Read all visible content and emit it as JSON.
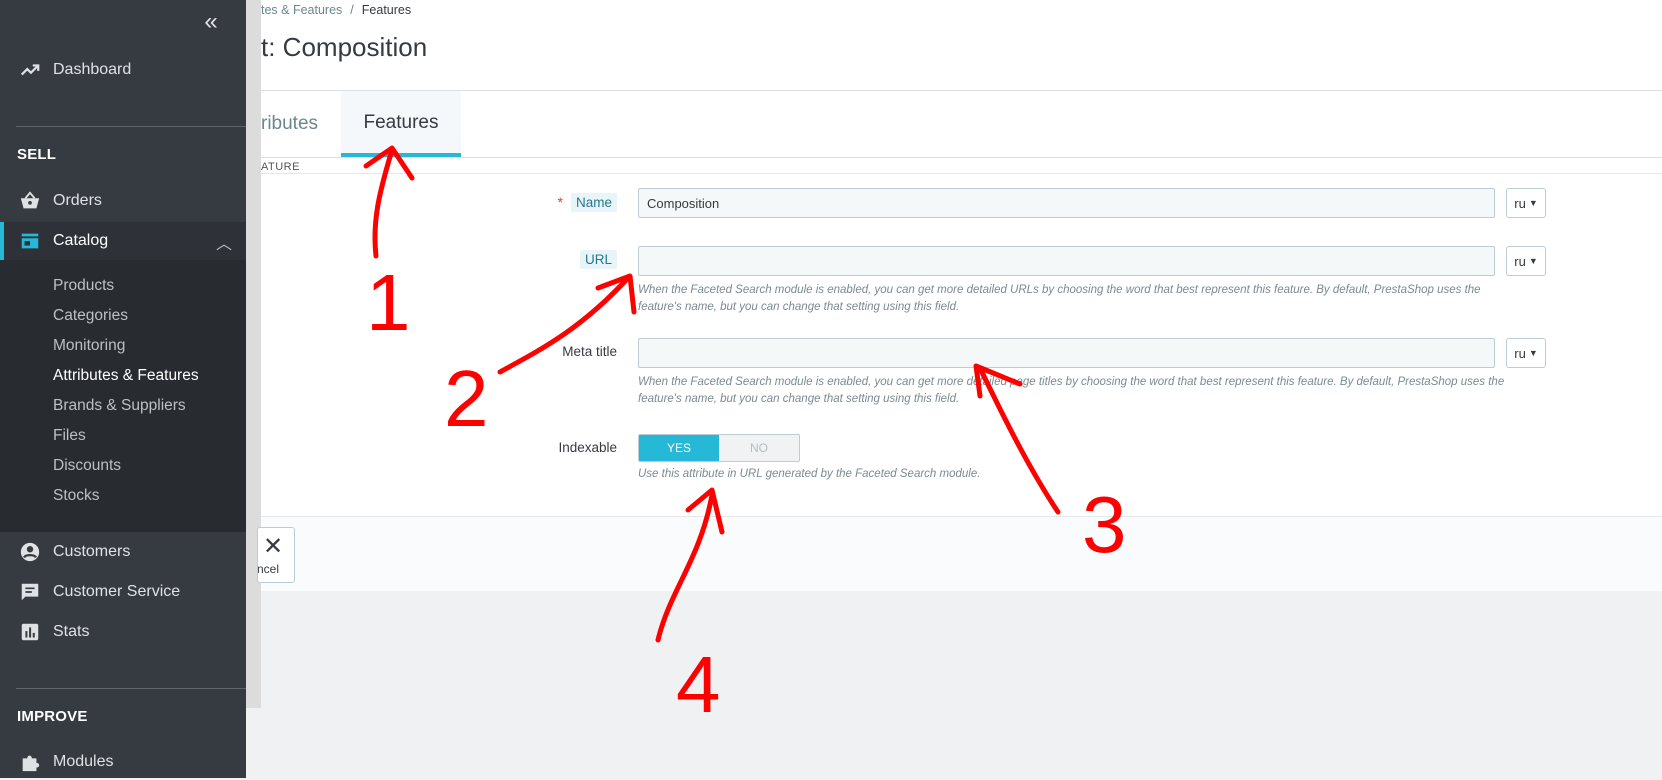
{
  "sidebar": {
    "collapse_icon": "double-chevron-left-icon",
    "dashboard": {
      "label": "Dashboard",
      "icon": "trending-up-icon"
    },
    "section_sell": "SELL",
    "orders": {
      "label": "Orders",
      "icon": "basket-icon"
    },
    "catalog": {
      "label": "Catalog",
      "icon": "store-icon",
      "expanded": true
    },
    "catalog_items": [
      "Products",
      "Categories",
      "Monitoring",
      "Attributes & Features",
      "Brands & Suppliers",
      "Files",
      "Discounts",
      "Stocks"
    ],
    "active_item": "Attributes & Features",
    "customers": {
      "label": "Customers",
      "icon": "account-circle-icon"
    },
    "customer_service": {
      "label": "Customer Service",
      "icon": "chat-icon"
    },
    "stats": {
      "label": "Stats",
      "icon": "bar-chart-icon"
    },
    "section_improve": "IMPROVE",
    "modules": {
      "label": "Modules",
      "icon": "puzzle-icon"
    }
  },
  "header": {
    "breadcrumb_parent": "tes & Features",
    "breadcrumb_sep": "/",
    "breadcrumb_current": "Features",
    "title": "t: Composition"
  },
  "tabs": [
    {
      "label": "ributes",
      "active": false
    },
    {
      "label": "Features",
      "active": true
    }
  ],
  "panel": {
    "heading": "ATURE",
    "name_required_mark": "*",
    "name_label": "Name",
    "name_value": "Composition",
    "name_lang": "ru",
    "url_label": "URL",
    "url_value": "",
    "url_lang": "ru",
    "url_help": "When the Faceted Search module is enabled, you can get more detailed URLs by choosing the word that best represent this feature. By default, PrestaShop uses the feature's name, but you can change that setting using this field.",
    "meta_label": "Meta title",
    "meta_value": "",
    "meta_lang": "ru",
    "meta_help": "When the Faceted Search module is enabled, you can get more detailed page titles by choosing the word that best represent this feature. By default, PrestaShop uses the feature's name, but you can change that setting using this field.",
    "indexable_label": "Indexable",
    "indexable_yes": "YES",
    "indexable_no": "NO",
    "indexable_value": "YES",
    "indexable_help": "Use this attribute in URL generated by the Faceted Search module.",
    "cancel_label": "ncel"
  },
  "annotations": {
    "color": "#ff0000",
    "numbers": [
      "1",
      "2",
      "3",
      "4"
    ]
  },
  "colors": {
    "accent": "#25b9d7",
    "sidebar_bg": "#363a41",
    "required": "#e0412d"
  }
}
